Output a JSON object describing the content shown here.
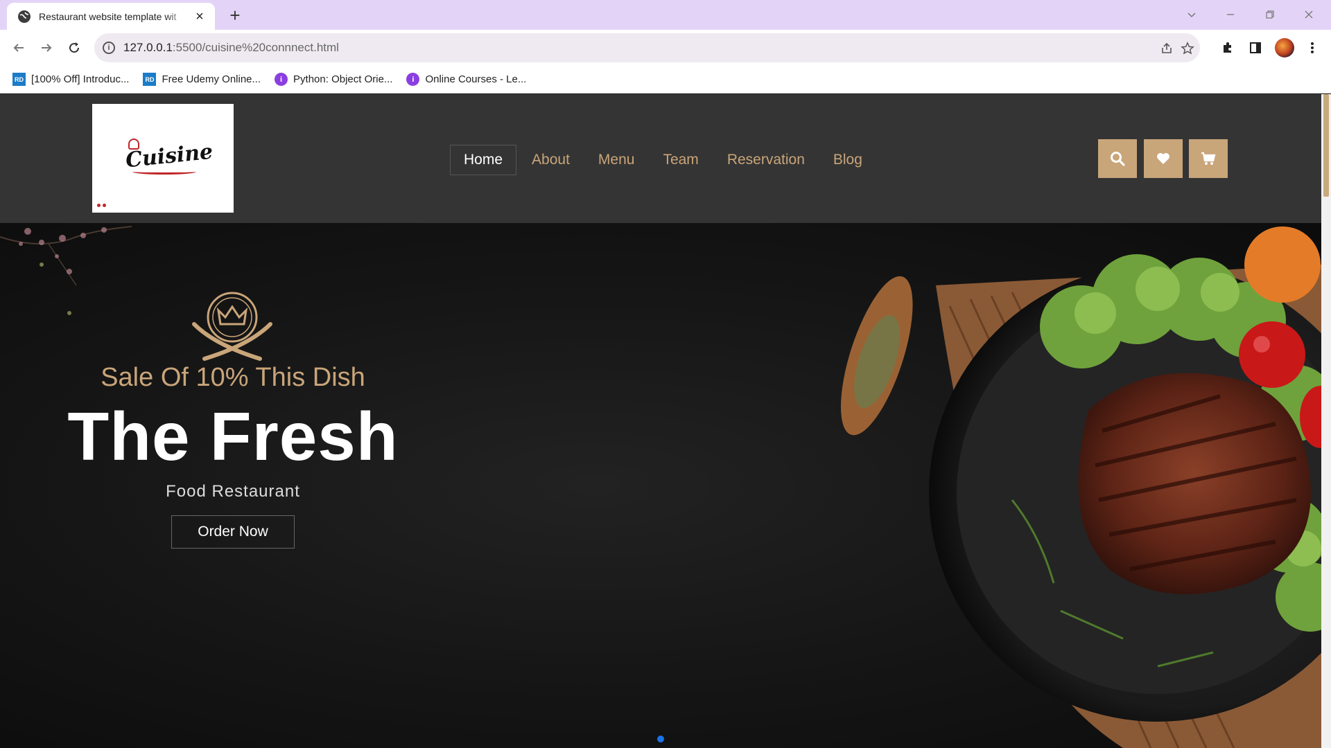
{
  "browser": {
    "tab_title": "Restaurant website template wit",
    "tab_close": "×",
    "new_tab": "+",
    "url_host": "127.0.0.1",
    "url_path": ":5500/cuisine%20connnect.html",
    "bookmarks": [
      {
        "label": "[100% Off] Introduc...",
        "icon": "rd-icon",
        "icon_text": "RD"
      },
      {
        "label": "Free Udemy Online...",
        "icon": "rd-icon",
        "icon_text": "RD"
      },
      {
        "label": "Python: Object Orie...",
        "icon": "course-icon",
        "icon_text": "i"
      },
      {
        "label": "Online Courses - Le...",
        "icon": "course-icon",
        "icon_text": "i"
      }
    ]
  },
  "site": {
    "logo_text": "Cuisine",
    "nav": [
      {
        "label": "Home",
        "active": true
      },
      {
        "label": "About",
        "active": false
      },
      {
        "label": "Menu",
        "active": false
      },
      {
        "label": "Team",
        "active": false
      },
      {
        "label": "Reservation",
        "active": false
      },
      {
        "label": "Blog",
        "active": false
      }
    ],
    "header_buttons": [
      "search-icon",
      "heart-icon",
      "cart-icon"
    ]
  },
  "hero": {
    "subtitle": "Sale Of 10% This Dish",
    "title": "The Fresh",
    "tagline": "Food Restaurant",
    "cta": "Order Now"
  },
  "colors": {
    "accent": "#c9a57a",
    "header_bg": "#343434",
    "tabstrip": "#e3d4f7",
    "slider_dot": "#1a73e8"
  }
}
